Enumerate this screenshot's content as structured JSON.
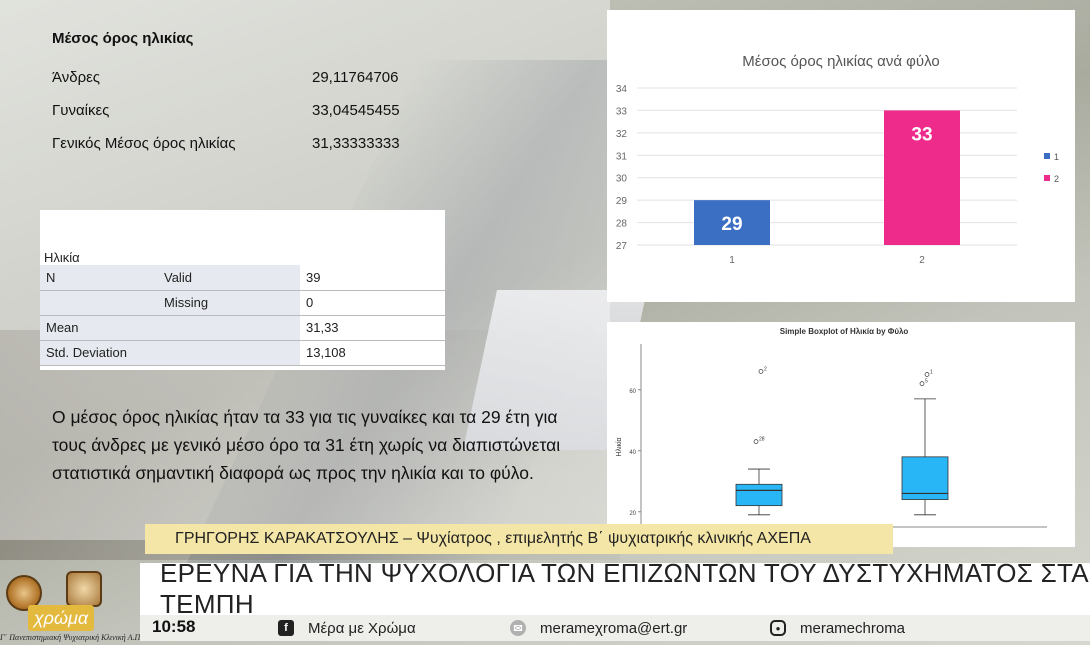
{
  "stats": {
    "heading": "Μέσος όρος ηλικίας",
    "rows": [
      {
        "label": "Άνδρες",
        "value": "29,11764706"
      },
      {
        "label": "Γυναίκες",
        "value": "33,04545455"
      },
      {
        "label": "Γενικός  Μέσος όρος ηλικίας",
        "value": "31,33333333"
      }
    ]
  },
  "spss": {
    "title": "Ηλικία",
    "rows": [
      {
        "c1": "N",
        "c2": "Valid",
        "c3": "39"
      },
      {
        "c1": "",
        "c2": "Missing",
        "c3": "0"
      },
      {
        "c1": "Mean",
        "c2": "",
        "c3": "31,33"
      },
      {
        "c1": "Std. Deviation",
        "c2": "",
        "c3": "13,108"
      }
    ]
  },
  "paragraph": "Ο μέσος όρος ηλικίας ήταν τα 33 για τις γυναίκες και τα 29 έτη για τους άνδρες με γενικό μέσο όρο τα 31 έτη χωρίς να διαπιστώνεται στατιστικά σημαντική διαφορά ως προς την ηλικία και το φύλο.",
  "name_banner": "ΓΡΗΓΟΡΗΣ ΚΑΡΑΚΑΤΣΟΥΛΗΣ – Ψυχίατρος , επιμελητής Β΄ ψυχιατρικής κλινικής ΑΧΕΠΑ",
  "headline": "ΕΡΕΥΝΑ ΓΙΑ ΤΗΝ ΨΥΧΟΛΟΓΙΑ ΤΩΝ ΕΠΙΖΩΝΤΩΝ ΤΟΥ ΔΥΣΤΥΧΗΜΑΤΟΣ ΣΤΑ ΤΕΜΠΗ",
  "logo": {
    "chroma": "χρώμα",
    "university": "Γ΄ Πανεπιστημιακή Ψυχιατρική Κλινική Α.Π.Θ."
  },
  "ticker": {
    "time": "10:58",
    "facebook": "Μέρα με Χρώμα",
    "email": "merameχroma@ert.gr",
    "instagram": "meramechroma",
    "icons": [
      "facebook-icon",
      "email-icon",
      "instagram-icon"
    ]
  },
  "colors": {
    "series1": "#3a6fc4",
    "series2": "#ee2a8a",
    "box": "#29b6f6",
    "banner": "#f3e6a6"
  },
  "chart_data": [
    {
      "type": "bar",
      "title": "Μέσος όρος ηλικίας ανά φύλο",
      "categories": [
        "1",
        "2"
      ],
      "values": [
        29,
        33
      ],
      "data_labels": [
        "29",
        "33"
      ],
      "ylim": [
        27,
        34
      ],
      "yticks": [
        27,
        28,
        29,
        30,
        31,
        32,
        33,
        34
      ],
      "legend": [
        "1",
        "2"
      ],
      "legend_position": "right",
      "grid": true
    },
    {
      "type": "boxplot",
      "title": "Simple Boxplot of Ηλικία by Φύλο",
      "ylabel": "Ηλικία",
      "yticks": [
        20,
        40,
        60
      ],
      "ylim": [
        15,
        75
      ],
      "groups": [
        {
          "q1": 22,
          "median": 27,
          "q3": 29,
          "whisker_low": 19,
          "whisker_high": 34,
          "outliers": [
            {
              "value": 43,
              "label": "28"
            },
            {
              "value": 66,
              "label": "2"
            }
          ]
        },
        {
          "q1": 24,
          "median": 26,
          "q3": 38,
          "whisker_low": 19,
          "whisker_high": 57,
          "outliers": [
            {
              "value": 62,
              "label": "5"
            },
            {
              "value": 65,
              "label": "1"
            }
          ]
        }
      ]
    }
  ]
}
